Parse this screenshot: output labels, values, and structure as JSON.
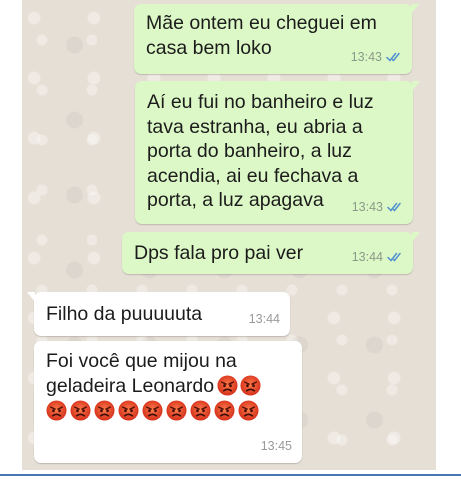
{
  "messages": [
    {
      "text": "Mãe ontem eu cheguei em\ncasa bem loko",
      "time": "13:43",
      "direction": "outgoing",
      "status": "delivered"
    },
    {
      "text": "Aí eu fui no banheiro e luz\ntava estranha, eu abria a\nporta do banheiro, a luz\nacendia, ai eu fechava a\nporta, a luz apagava",
      "time": "13:43",
      "direction": "outgoing",
      "status": "delivered"
    },
    {
      "text": "Dps fala pro pai ver",
      "time": "13:44",
      "direction": "outgoing",
      "status": "delivered"
    },
    {
      "text": "Filho da puuuuuta",
      "time": "13:44",
      "direction": "incoming"
    },
    {
      "text": "Foi você que mijou na\ngeladeira Leonardo",
      "time": "13:45",
      "direction": "incoming",
      "emoji": "angry-face",
      "emoji_count": 11
    }
  ],
  "colors": {
    "outgoing_bubble": "#dcf8c6",
    "incoming_bubble": "#ffffff",
    "chat_background": "#e6dfd6",
    "tick_color": "#4f8fd0",
    "emoji_red": "#e24a2b"
  }
}
